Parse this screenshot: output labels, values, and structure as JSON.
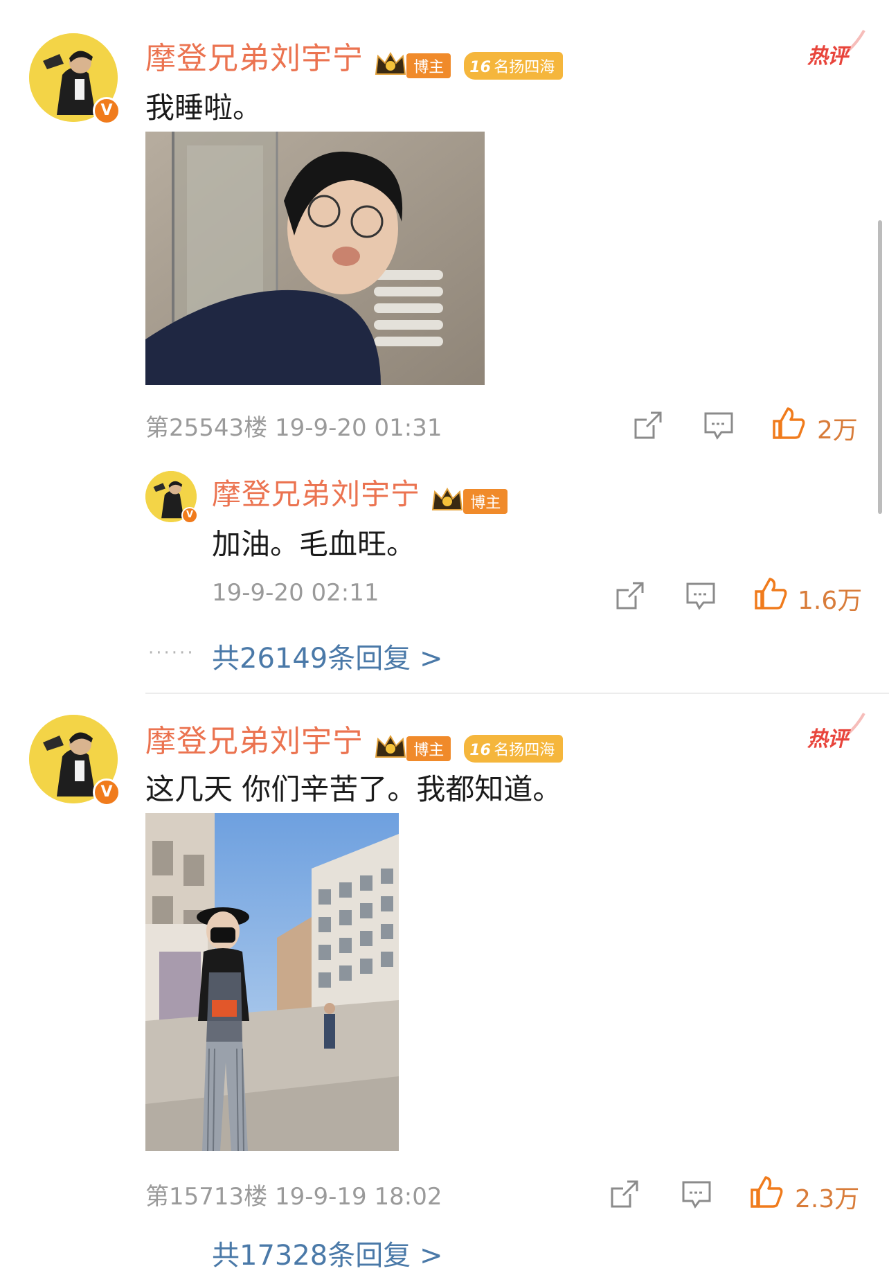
{
  "comments": [
    {
      "username": "摩登兄弟刘宇宁",
      "badge_blogger": "博主",
      "badge_level": "16",
      "badge_fame": "名扬四海",
      "hot_tag": "热评",
      "text": "我睡啦。",
      "meta": "第25543楼 19-9-20 01:31",
      "likes": "2万",
      "reply": {
        "username": "摩登兄弟刘宇宁",
        "badge_blogger": "博主",
        "text": "加油。毛血旺。",
        "meta": "19-9-20 02:11",
        "likes": "1.6万"
      },
      "dots": "······",
      "more_replies": "共26149条回复 >"
    },
    {
      "username": "摩登兄弟刘宇宁",
      "badge_blogger": "博主",
      "badge_level": "16",
      "badge_fame": "名扬四海",
      "hot_tag": "热评",
      "text": "这几天 你们辛苦了。我都知道。",
      "meta": "第15713楼 19-9-19 18:02",
      "likes": "2.3万",
      "more_replies_partial": "共17328条回复 >"
    }
  ],
  "colors": {
    "username": "#eb7350",
    "blogger_badge": "#f08a2a",
    "fame_badge": "#f5b63c",
    "hot_tag": "#e8443b",
    "like_icon": "#f07b1c",
    "link": "#4a79a8"
  },
  "icons": [
    "verified-icon",
    "crown-icon",
    "share-icon",
    "comment-icon",
    "like-icon",
    "hot-comment-icon"
  ]
}
